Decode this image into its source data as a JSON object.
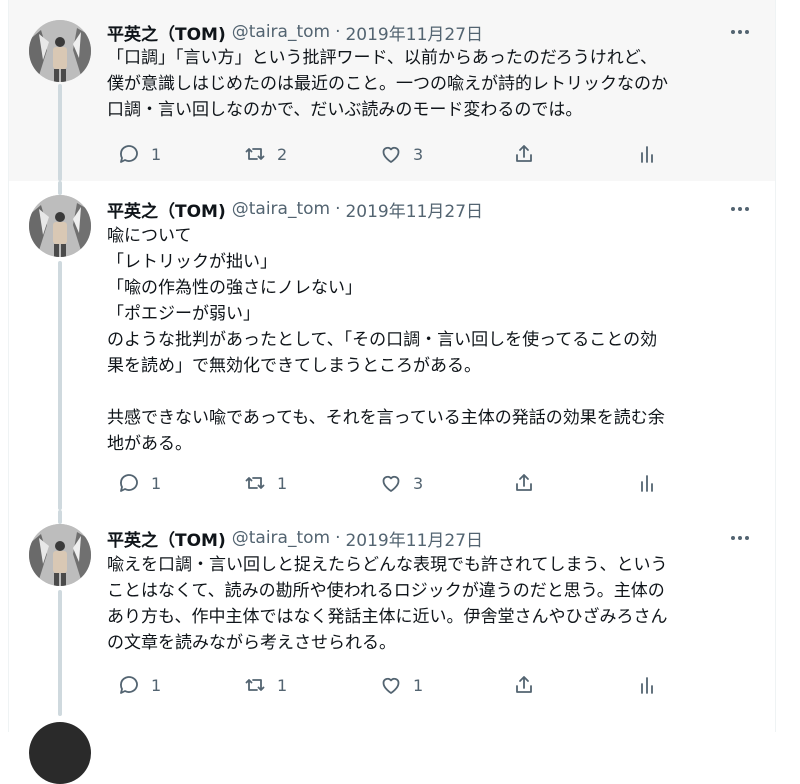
{
  "tweets": [
    {
      "name": "平英之（TOM)",
      "handle": "@taira_tom",
      "sep": "·",
      "date": "2019年11月27日",
      "text": "「口調」「言い方」という批評ワード、以前からあったのだろうけれど、\n僕が意識しはじめたのは最近のこと。一つの喩えが詩的レトリックなのか\n口調・言い回しなのかで、だいぶ読みのモード変わるのでは。",
      "replies": "1",
      "retweets": "2",
      "likes": "3"
    },
    {
      "name": "平英之（TOM)",
      "handle": "@taira_tom",
      "sep": "·",
      "date": "2019年11月27日",
      "text": "喩について\n「レトリックが拙い」\n「喩の作為性の強さにノレない」\n「ポエジーが弱い」\nのような批判があったとして、「その口調・言い回しを使ってることの効\n果を読め」で無効化できてしまうところがある。\n\n共感できない喩であっても、それを言っている主体の発話の効果を読む余\n地がある。",
      "replies": "1",
      "retweets": "1",
      "likes": "3"
    },
    {
      "name": "平英之（TOM)",
      "handle": "@taira_tom",
      "sep": "·",
      "date": "2019年11月27日",
      "text": "喩えを口調・言い回しと捉えたらどんな表現でも許されてしまう、という\nことはなくて、読みの勘所や使われるロジックが違うのだと思う。主体の\nあり方も、作中主体ではなく発話主体に近い。伊舎堂さんやひざみろさん\nの文章を読みながら考えさせられる。",
      "replies": "1",
      "retweets": "1",
      "likes": "1"
    }
  ],
  "icons": [
    "reply-icon",
    "retweet-icon",
    "like-icon",
    "share-icon",
    "analytics-icon",
    "more-icon"
  ],
  "colors": {
    "secondary_text": "#536471",
    "thread_line": "#cfd9de",
    "highlight_bg": "#f7f7f7"
  }
}
